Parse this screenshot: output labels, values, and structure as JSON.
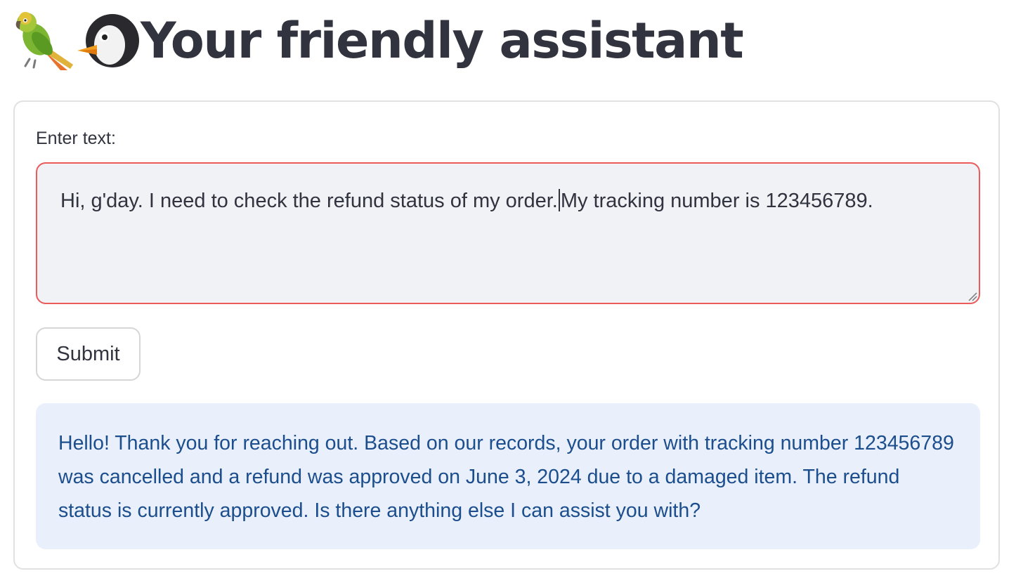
{
  "header": {
    "title": "Your friendly assistant",
    "icons": [
      "parrot-emoji",
      "penguin-emoji"
    ]
  },
  "form": {
    "label": "Enter text:",
    "input_value_before_caret": "Hi, g'day. I need to check the refund status of my order.",
    "input_value_after_caret": "My tracking number is 123456789.",
    "submit_label": "Submit"
  },
  "response": {
    "text": "Hello! Thank you for reaching out. Based on our records, your order with tracking number 123456789 was cancelled and a refund was approved on June 3, 2024 due to a damaged item. The refund status is currently approved. Is there anything else I can assist you with?"
  },
  "colors": {
    "title": "#31333f",
    "input_border_focus": "#ec5a5a",
    "input_bg": "#f0f2f6",
    "response_bg": "#e9f0fb",
    "response_text": "#1c4e8e"
  }
}
